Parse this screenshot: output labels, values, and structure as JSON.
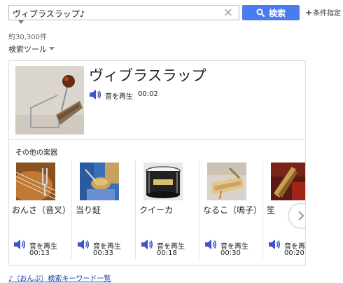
{
  "search": {
    "query": "ヴィブラスラップ♪",
    "clear_icon": "×",
    "button_label": "検索",
    "condition_label": "条件指定",
    "condition_plus": "+"
  },
  "result_count": "約30,300件",
  "search_tools_label": "検索ツール",
  "main": {
    "title": "ヴィブラスラップ",
    "play_label": "音を再生",
    "duration": "00:02"
  },
  "other_section_label": "その他の楽器",
  "items": [
    {
      "name": "おんさ（音叉）",
      "play_label": "音を再生",
      "duration": "00:13"
    },
    {
      "name": "当り鉦",
      "play_label": "音を再生",
      "duration": "00:33"
    },
    {
      "name": "クイーカ",
      "play_label": "音を再生",
      "duration": "00:18"
    },
    {
      "name": "なるこ（鳴子）",
      "play_label": "音を再生",
      "duration": "00:30"
    },
    {
      "name": "笙",
      "play_label": "音を再生",
      "duration": "00:20"
    }
  ],
  "footer_link": "♪（おんぷ）検索キーワード一覧",
  "colors": {
    "accent": "#4a7cf0",
    "speaker": "#3b55c9",
    "link": "#1a3fa0"
  },
  "icons": {
    "search": "search-icon",
    "speaker": "speaker-icon",
    "next": "chevron-right-icon",
    "clear": "close-icon"
  }
}
